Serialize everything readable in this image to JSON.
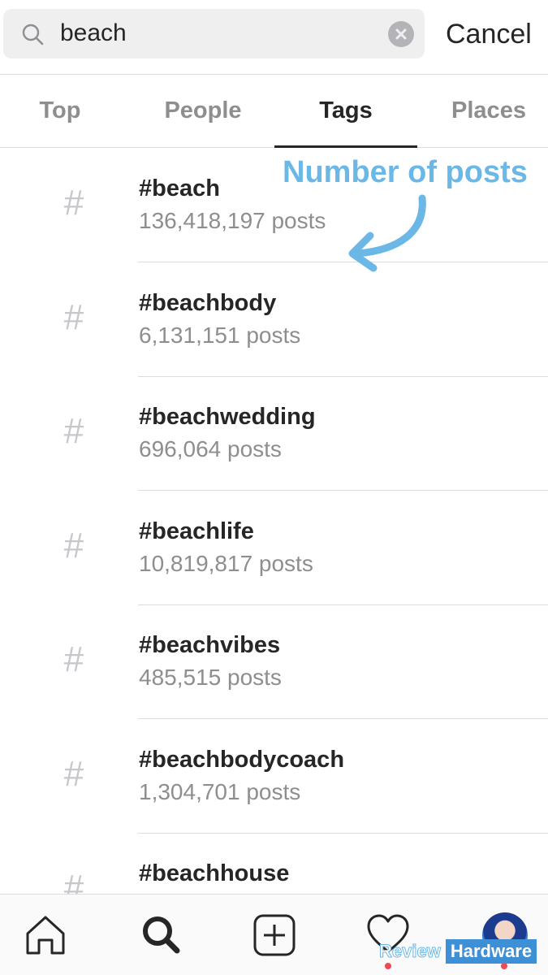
{
  "search": {
    "query": "beach",
    "cancel_label": "Cancel"
  },
  "tabs": [
    {
      "label": "Top"
    },
    {
      "label": "People"
    },
    {
      "label": "Tags",
      "active": true
    },
    {
      "label": "Places"
    }
  ],
  "results": [
    {
      "icon": "#",
      "tag": "#beach",
      "count": "136,418,197 posts"
    },
    {
      "icon": "#",
      "tag": "#beachbody",
      "count": "6,131,151 posts"
    },
    {
      "icon": "#",
      "tag": "#beachwedding",
      "count": "696,064 posts"
    },
    {
      "icon": "#",
      "tag": "#beachlife",
      "count": "10,819,817 posts"
    },
    {
      "icon": "#",
      "tag": "#beachvibes",
      "count": "485,515 posts"
    },
    {
      "icon": "#",
      "tag": "#beachbodycoach",
      "count": "1,304,701 posts"
    },
    {
      "icon": "#",
      "tag": "#beachhouse",
      "count": ""
    }
  ],
  "annotation": {
    "text": "Number of posts",
    "color": "#6bb7e6"
  },
  "bottom_nav": {
    "items": [
      "home-icon",
      "search-icon",
      "new-post-icon",
      "activity-heart-icon",
      "profile-avatar"
    ],
    "notification_color": "#ed4956"
  },
  "watermark": {
    "part1": "Review",
    "part2": "Hardware"
  }
}
